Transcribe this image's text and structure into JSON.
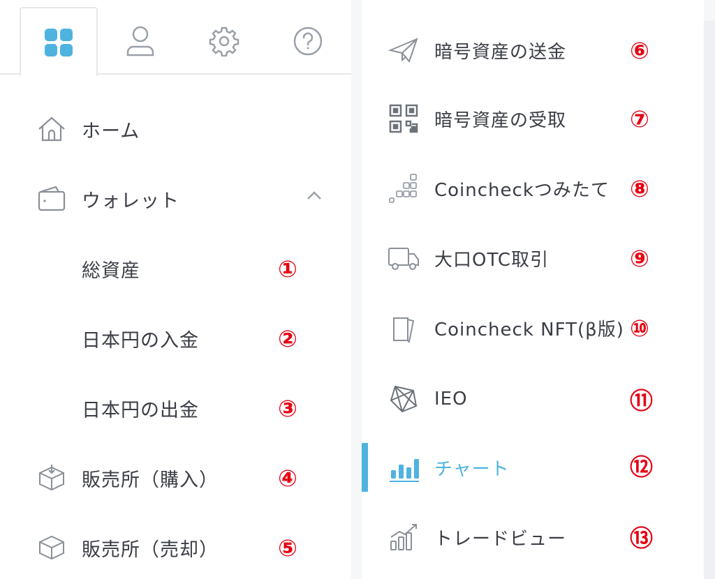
{
  "tabs": [
    {
      "icon": "grid-icon",
      "active": true
    },
    {
      "icon": "user-icon",
      "active": false
    },
    {
      "icon": "gear-icon",
      "active": false
    },
    {
      "icon": "help-icon",
      "active": false
    }
  ],
  "left_menu": {
    "home": {
      "label": "ホーム",
      "icon": "home-icon"
    },
    "wallet": {
      "label": "ウォレット",
      "icon": "wallet-icon",
      "expanded": true
    },
    "total_assets": {
      "label": "総資産",
      "marker": "①"
    },
    "jpy_deposit": {
      "label": "日本円の入金",
      "marker": "②"
    },
    "jpy_withdraw": {
      "label": "日本円の出金",
      "marker": "③"
    },
    "exchange_buy": {
      "label": "販売所（購入）",
      "marker": "④",
      "icon": "box-in-icon"
    },
    "exchange_sell": {
      "label": "販売所（売却）",
      "marker": "⑤",
      "icon": "box-icon"
    }
  },
  "right_menu": {
    "crypto_send": {
      "label": "暗号資産の送金",
      "marker": "⑥",
      "icon": "paper-plane-icon"
    },
    "crypto_receive": {
      "label": "暗号資産の受取",
      "marker": "⑦",
      "icon": "qr-code-icon"
    },
    "tsumitate": {
      "label": "Coincheckつみたて",
      "marker": "⑧",
      "icon": "blocks-icon"
    },
    "otc": {
      "label": "大口OTC取引",
      "marker": "⑨",
      "icon": "truck-icon"
    },
    "nft": {
      "label": "Coincheck NFT(β版)",
      "marker": "⑩",
      "icon": "cards-icon"
    },
    "ieo": {
      "label": "IEO",
      "marker": "⑪",
      "icon": "gem-icon"
    },
    "chart": {
      "label": "チャート",
      "marker": "⑫",
      "icon": "bar-chart-icon",
      "active": true
    },
    "tradeview": {
      "label": "トレードビュー",
      "marker": "⑬",
      "icon": "line-chart-icon"
    }
  },
  "colors": {
    "accent": "#4fb3e0",
    "marker": "#e60012",
    "text": "#3a3d44",
    "icon": "#8a8f98"
  }
}
